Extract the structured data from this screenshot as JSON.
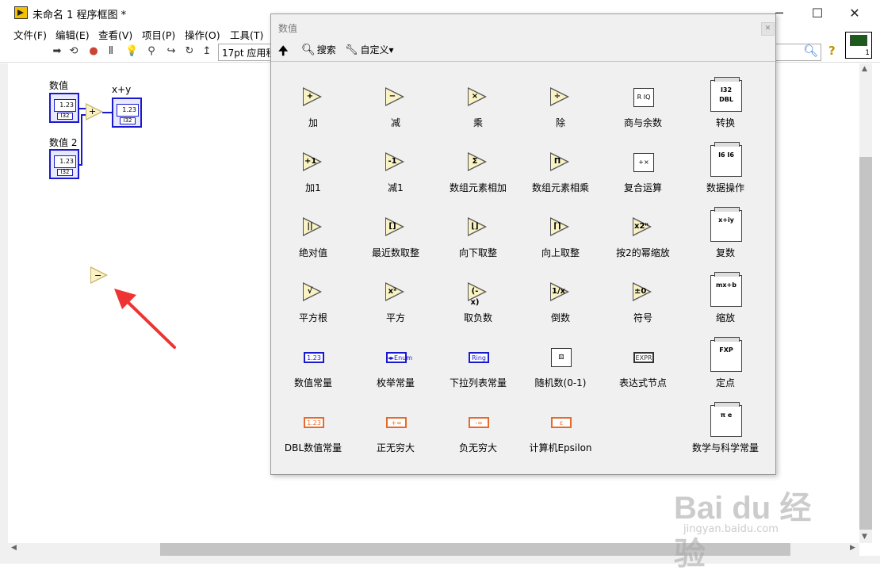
{
  "window": {
    "title": "未命名 1 程序框图 *",
    "min": "─",
    "max": "☐",
    "close": "✕"
  },
  "menu": [
    "文件(F)",
    "编辑(E)",
    "查看(V)",
    "项目(P)",
    "操作(O)",
    "工具(T)"
  ],
  "toolbar": {
    "font": "17pt 应用程",
    "icons": [
      "run-arrow-icon",
      "run-continuous-icon",
      "abort-icon",
      "pause-icon",
      "highlight-icon",
      "retain-wire-icon",
      "step-into-icon",
      "step-over-icon",
      "step-out-icon"
    ]
  },
  "vi_icon_number": "1",
  "diagram": {
    "node1_label": "数值",
    "node2_label": "数值 2",
    "result_label": "x+y",
    "display": "1.23",
    "type": "I32",
    "add_symbol": "+",
    "loose_node_symbol": "−"
  },
  "palette": {
    "title": "数值",
    "close": "✕",
    "up": "🠉",
    "search": "搜索",
    "customize": "自定义▾",
    "items": [
      {
        "label": "加",
        "icon": "add-icon",
        "sym": "+"
      },
      {
        "label": "减",
        "icon": "subtract-icon",
        "sym": "−"
      },
      {
        "label": "乘",
        "icon": "multiply-icon",
        "sym": "×"
      },
      {
        "label": "除",
        "icon": "divide-icon",
        "sym": "÷"
      },
      {
        "label": "商与余数",
        "icon": "quotient-remainder-icon",
        "sym": "R IQ"
      },
      {
        "label": "转换",
        "icon": "conversion-folder-icon",
        "sym": "I32 DBL"
      },
      {
        "label": "加1",
        "icon": "increment-icon",
        "sym": "+1"
      },
      {
        "label": "减1",
        "icon": "decrement-icon",
        "sym": "-1"
      },
      {
        "label": "数组元素相加",
        "icon": "add-array-elements-icon",
        "sym": "Σ"
      },
      {
        "label": "数组元素相乘",
        "icon": "multiply-array-elements-icon",
        "sym": "Π"
      },
      {
        "label": "复合运算",
        "icon": "compound-arithmetic-icon",
        "sym": "+×"
      },
      {
        "label": "数据操作",
        "icon": "data-manipulation-folder-icon",
        "sym": "I6 I6"
      },
      {
        "label": "绝对值",
        "icon": "absolute-value-icon",
        "sym": "||"
      },
      {
        "label": "最近数取整",
        "icon": "round-nearest-icon",
        "sym": "[]"
      },
      {
        "label": "向下取整",
        "icon": "round-down-icon",
        "sym": "⌊⌋"
      },
      {
        "label": "向上取整",
        "icon": "round-up-icon",
        "sym": "⌈⌉"
      },
      {
        "label": "按2的幂缩放",
        "icon": "scale-power-two-icon",
        "sym": "x2ⁿ"
      },
      {
        "label": "复数",
        "icon": "complex-folder-icon",
        "sym": "x+iy"
      },
      {
        "label": "平方根",
        "icon": "square-root-icon",
        "sym": "√"
      },
      {
        "label": "平方",
        "icon": "square-icon",
        "sym": "x²"
      },
      {
        "label": "取负数",
        "icon": "negate-icon",
        "sym": "(-x)"
      },
      {
        "label": "倒数",
        "icon": "reciprocal-icon",
        "sym": "1/x"
      },
      {
        "label": "符号",
        "icon": "sign-icon",
        "sym": "±0"
      },
      {
        "label": "缩放",
        "icon": "scaling-folder-icon",
        "sym": "mx+b"
      },
      {
        "label": "数值常量",
        "icon": "numeric-constant-icon",
        "sym": "1.23"
      },
      {
        "label": "枚举常量",
        "icon": "enum-constant-icon",
        "sym": "◂▸Enum"
      },
      {
        "label": "下拉列表常量",
        "icon": "ring-constant-icon",
        "sym": "Ring"
      },
      {
        "label": "随机数(0-1)",
        "icon": "random-number-icon",
        "sym": "⚄"
      },
      {
        "label": "表达式节点",
        "icon": "expression-node-icon",
        "sym": "EXPR"
      },
      {
        "label": "定点",
        "icon": "fixed-point-folder-icon",
        "sym": "FXP"
      },
      {
        "label": "DBL数值常量",
        "icon": "dbl-constant-icon",
        "sym": "1.23"
      },
      {
        "label": "正无穷大",
        "icon": "positive-infinity-icon",
        "sym": "+∞"
      },
      {
        "label": "负无穷大",
        "icon": "negative-infinity-icon",
        "sym": "-∞"
      },
      {
        "label": "计算机Epsilon",
        "icon": "epsilon-icon",
        "sym": "ε"
      },
      {
        "label": "数学与科学常量",
        "icon": "math-constants-folder-icon",
        "sym": "π e"
      }
    ]
  },
  "watermark": {
    "logo": "Bai du 经验",
    "url": "jingyan.baidu.com"
  },
  "colors": {
    "wire": "#1a1acc",
    "node_fill": "#f8f2c4",
    "arrow": "#ee3333",
    "dbl_orange": "#e86a2a"
  }
}
